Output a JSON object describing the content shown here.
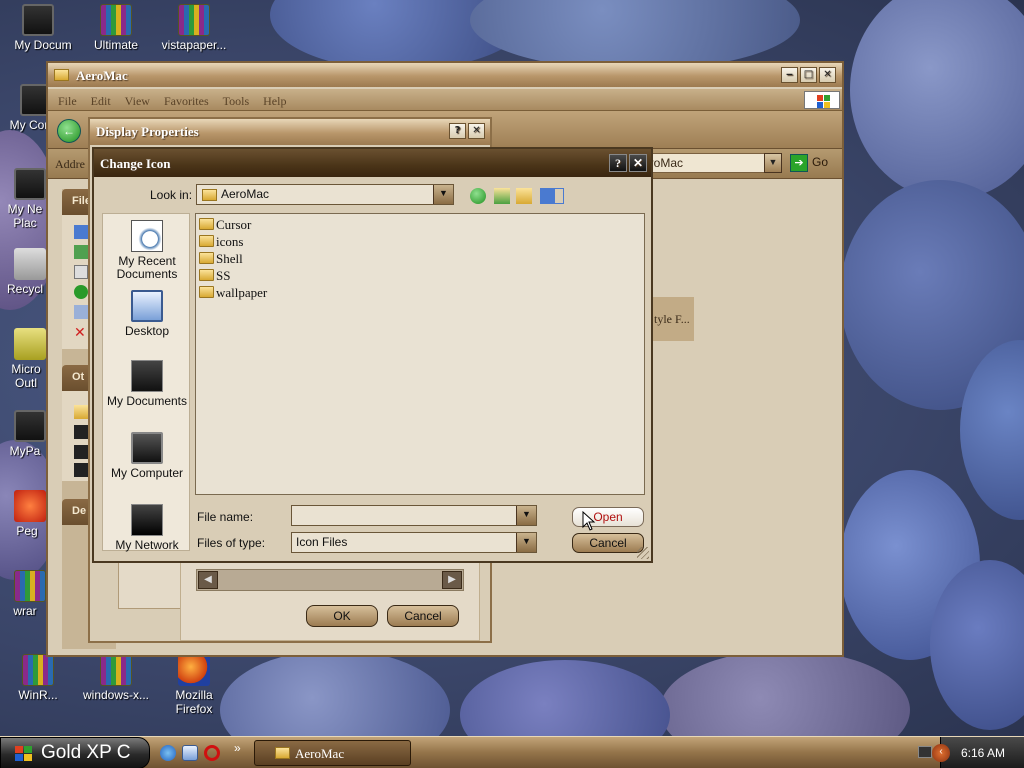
{
  "desktop": {
    "icons": [
      {
        "label": "My Docum",
        "icon": "my-documents-icon"
      },
      {
        "label": "Ultimate",
        "icon": "winrar-archive-icon"
      },
      {
        "label": "vistapaper...",
        "icon": "winrar-archive-icon"
      },
      {
        "label": "My Com",
        "icon": "my-computer-icon"
      },
      {
        "label": "My Ne Plac",
        "icon": "my-network-places-icon"
      },
      {
        "label": "Recycl",
        "icon": "recycle-bin-icon"
      },
      {
        "label": "Micro Outl",
        "icon": "outlook-icon"
      },
      {
        "label": "MyPa",
        "icon": "shortcut-icon"
      },
      {
        "label": "Peg",
        "icon": "pegasus-icon"
      },
      {
        "label": "wrar",
        "icon": "winrar-archive-icon"
      },
      {
        "label": "WinR...",
        "icon": "winrar-archive-icon"
      },
      {
        "label": "windows-x...",
        "icon": "winrar-archive-icon"
      },
      {
        "label": "Mozilla Firefox",
        "icon": "firefox-icon"
      }
    ]
  },
  "explorer": {
    "title": "AeroMac",
    "menu": [
      "File",
      "Edit",
      "View",
      "Favorites",
      "Tools",
      "Help"
    ],
    "address_label": "Addre",
    "address_value": "eroMac",
    "go_label": "Go",
    "left_pane": {
      "section1_header": "File",
      "section2_header": "Ot",
      "section3_header": "De"
    },
    "style_item_label": "tyle F..."
  },
  "display_properties": {
    "title": "Display Properties",
    "ok_label": "OK",
    "cancel_label": "Cancel"
  },
  "change_icon": {
    "title": "Change Icon",
    "look_in_label": "Look in:",
    "look_in_value": "AeroMac",
    "places": [
      {
        "label": "My Recent Documents"
      },
      {
        "label": "Desktop"
      },
      {
        "label": "My Documents"
      },
      {
        "label": "My Computer"
      },
      {
        "label": "My Network"
      }
    ],
    "files": [
      "Cursor",
      "icons",
      "Shell",
      "SS",
      "wallpaper"
    ],
    "file_name_label": "File name:",
    "file_name_value": "",
    "files_of_type_label": "Files of type:",
    "files_of_type_value": "Icon Files",
    "open_label": "Open",
    "cancel_label": "Cancel"
  },
  "taskbar": {
    "start_label": "Gold XP C",
    "task_label": "AeroMac",
    "clock": "6:16 AM",
    "chevron": "»"
  },
  "colors": {
    "accent": "#9c7a50",
    "window_bg": "#d9cdb6",
    "title_dark": "#3a2610"
  }
}
